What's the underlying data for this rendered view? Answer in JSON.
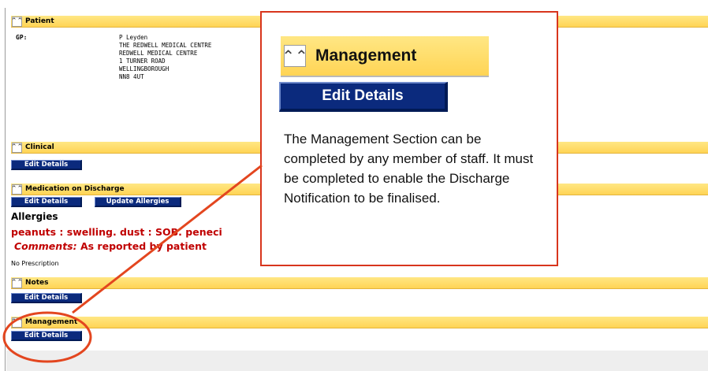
{
  "icons": {
    "collapse": "⌃⌃"
  },
  "sections": {
    "patient": {
      "title": "Patient"
    },
    "clinical": {
      "title": "Clinical",
      "edit_label": "Edit Details"
    },
    "medication": {
      "title": "Medication on Discharge",
      "edit_label": "Edit Details",
      "update_allergies_label": "Update Allergies"
    },
    "notes": {
      "title": "Notes",
      "edit_label": "Edit Details"
    },
    "management": {
      "title": "Management",
      "edit_label": "Edit Details"
    }
  },
  "gp": {
    "label": "GP:",
    "lines": [
      "P Leyden",
      "THE REDWELL MEDICAL CENTRE",
      "REDWELL MEDICAL CENTRE",
      "1 TURNER ROAD",
      "WELLINGBOROUGH",
      "NN8 4UT"
    ]
  },
  "allergies": {
    "title": "Allergies",
    "line": "peanuts : swelling.  dust : SOB.  peneci",
    "comments_label": "Comments:",
    "comments_value": " As reported by patient"
  },
  "prescription": {
    "status": "No Prescription"
  },
  "callout": {
    "title": "Management",
    "button_label": "Edit Details",
    "text": "The Management Section can be completed by any member of staff.  It must be completed to enable the Discharge Notification to be finalised."
  },
  "colors": {
    "header_yellow": "#ffd455",
    "button_blue": "#0b2a7d",
    "alert_red": "#c00000",
    "callout_border": "#d8351d"
  }
}
